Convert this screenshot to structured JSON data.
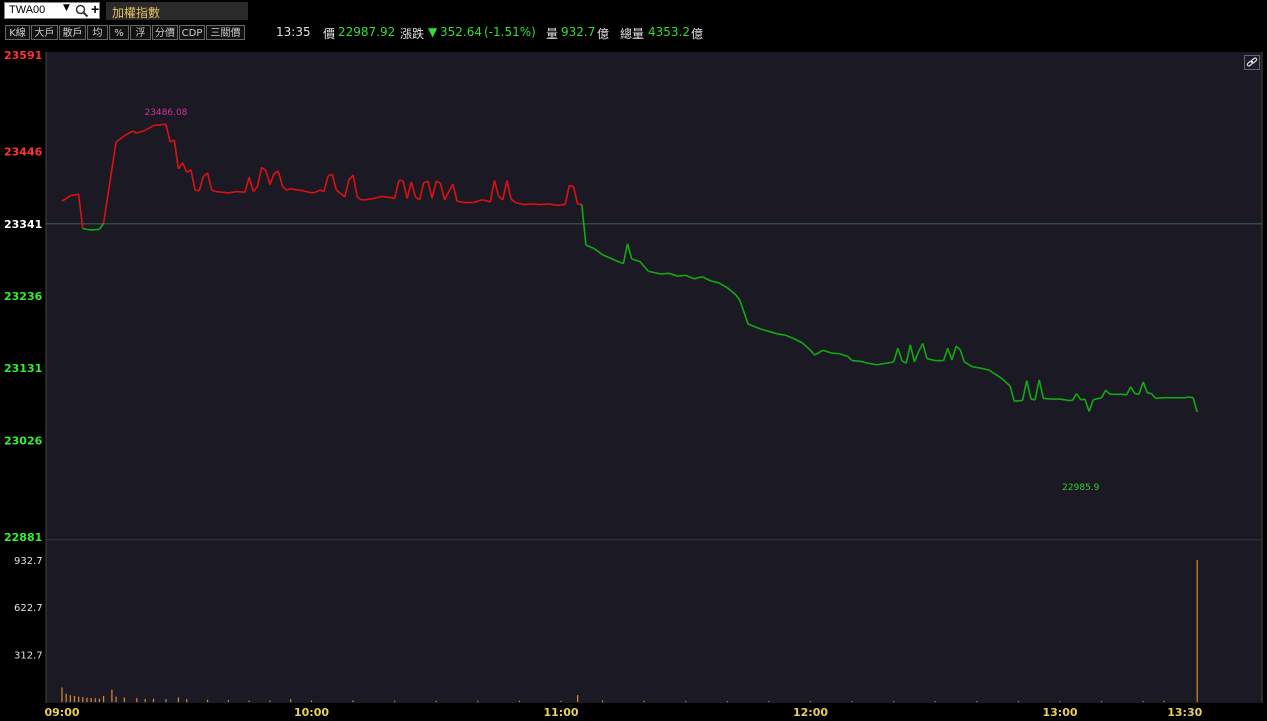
{
  "symbol": {
    "code": "TWA00",
    "title": "加權指數"
  },
  "toolbar": {
    "buttons": [
      "K線",
      "大戶",
      "散戶",
      "均",
      "%",
      "浮",
      "分價",
      "CDP",
      "三關價"
    ]
  },
  "quote": {
    "time": "13:35",
    "price_label": "價",
    "price": "22987.92",
    "change_label": "漲跌",
    "change_arrow": "▼",
    "change": "352.64",
    "change_pct": "(-1.51%)",
    "volume_label": "量",
    "volume": "932.7",
    "volume_unit": "億",
    "total_label": "總量",
    "total": "4353.2",
    "total_unit": "億"
  },
  "colors": {
    "up": "#dd1111",
    "down": "#11aa11",
    "reference": "#3a5a4a",
    "volume": "#e08a30",
    "high_label": "#cc3399",
    "low_label": "#33cc33",
    "background": "#1b1a24"
  },
  "chart_data": {
    "type": "line",
    "title": "加權指數",
    "x_ticks": [
      "09:00",
      "10:00",
      "11:00",
      "12:00",
      "13:00",
      "13:30"
    ],
    "y_ticks": [
      23591,
      23446,
      23341,
      23236,
      23131,
      23026,
      22881
    ],
    "ylim": [
      22881,
      23591
    ],
    "reference": 23341,
    "high": {
      "value": "23486.08",
      "time": "09:25"
    },
    "low": {
      "value": "22985.9",
      "time": "13:05"
    },
    "series": [
      {
        "values": [
          [
            "09:00",
            23374
          ],
          [
            "09:02",
            23382
          ],
          [
            "09:04",
            23384
          ],
          [
            "09:05",
            23334
          ],
          [
            "09:07",
            23332
          ],
          [
            "09:09",
            23333
          ],
          [
            "09:10",
            23342
          ],
          [
            "09:13",
            23460
          ],
          [
            "09:15",
            23469
          ],
          [
            "09:17",
            23476
          ],
          [
            "09:18",
            23473
          ],
          [
            "09:20",
            23477
          ],
          [
            "09:22",
            23484
          ],
          [
            "09:25",
            23486
          ],
          [
            "09:26",
            23460
          ],
          [
            "09:27",
            23463
          ],
          [
            "09:28",
            23421
          ],
          [
            "09:29",
            23430
          ],
          [
            "09:30",
            23416
          ],
          [
            "09:31",
            23420
          ],
          [
            "09:32",
            23390
          ],
          [
            "09:33",
            23389
          ],
          [
            "09:34",
            23410
          ],
          [
            "09:35",
            23415
          ],
          [
            "09:36",
            23390
          ],
          [
            "09:37",
            23388
          ],
          [
            "09:40",
            23386
          ],
          [
            "09:42",
            23388
          ],
          [
            "09:44",
            23387
          ],
          [
            "09:45",
            23409
          ],
          [
            "09:46",
            23388
          ],
          [
            "09:47",
            23395
          ],
          [
            "09:48",
            23423
          ],
          [
            "09:49",
            23419
          ],
          [
            "09:50",
            23398
          ],
          [
            "09:51",
            23414
          ],
          [
            "09:52",
            23418
          ],
          [
            "09:53",
            23396
          ],
          [
            "09:54",
            23390
          ],
          [
            "09:55",
            23392
          ],
          [
            "09:58",
            23389
          ],
          [
            "10:00",
            23386
          ],
          [
            "10:01",
            23387
          ],
          [
            "10:02",
            23390
          ],
          [
            "10:03",
            23388
          ],
          [
            "10:04",
            23411
          ],
          [
            "10:05",
            23413
          ],
          [
            "10:06",
            23390
          ],
          [
            "10:07",
            23385
          ],
          [
            "10:08",
            23380
          ],
          [
            "10:09",
            23405
          ],
          [
            "10:10",
            23412
          ],
          [
            "10:11",
            23380
          ],
          [
            "10:12",
            23376
          ],
          [
            "10:13",
            23376
          ],
          [
            "10:15",
            23378
          ],
          [
            "10:17",
            23381
          ],
          [
            "10:19",
            23379
          ],
          [
            "10:20",
            23378
          ],
          [
            "10:21",
            23404
          ],
          [
            "10:22",
            23404
          ],
          [
            "10:23",
            23378
          ],
          [
            "10:24",
            23402
          ],
          [
            "10:25",
            23380
          ],
          [
            "10:26",
            23376
          ],
          [
            "10:27",
            23401
          ],
          [
            "10:28",
            23403
          ],
          [
            "10:29",
            23378
          ],
          [
            "10:30",
            23403
          ],
          [
            "10:31",
            23400
          ],
          [
            "10:32",
            23376
          ],
          [
            "10:34",
            23399
          ],
          [
            "10:35",
            23374
          ],
          [
            "10:37",
            23372
          ],
          [
            "10:39",
            23372
          ],
          [
            "10:41",
            23376
          ],
          [
            "10:43",
            23373
          ],
          [
            "10:44",
            23404
          ],
          [
            "10:45",
            23381
          ],
          [
            "10:46",
            23376
          ],
          [
            "10:47",
            23404
          ],
          [
            "10:48",
            23377
          ],
          [
            "10:49",
            23372
          ],
          [
            "10:51",
            23369
          ],
          [
            "10:53",
            23370
          ],
          [
            "10:55",
            23369
          ],
          [
            "10:57",
            23370
          ],
          [
            "10:59",
            23368
          ],
          [
            "11:01",
            23369
          ],
          [
            "11:02",
            23397
          ],
          [
            "11:03",
            23395
          ],
          [
            "11:04",
            23370
          ],
          [
            "11:05",
            23369
          ],
          [
            "11:06",
            23310
          ],
          [
            "11:08",
            23305
          ],
          [
            "11:10",
            23296
          ],
          [
            "11:13",
            23288
          ],
          [
            "11:15",
            23283
          ],
          [
            "11:16",
            23312
          ],
          [
            "11:17",
            23290
          ],
          [
            "11:19",
            23286
          ],
          [
            "11:21",
            23272
          ],
          [
            "11:24",
            23268
          ],
          [
            "11:26",
            23269
          ],
          [
            "11:28",
            23265
          ],
          [
            "11:30",
            23266
          ],
          [
            "11:32",
            23261
          ],
          [
            "11:34",
            23264
          ],
          [
            "11:36",
            23258
          ],
          [
            "11:38",
            23255
          ],
          [
            "11:40",
            23248
          ],
          [
            "11:42",
            23238
          ],
          [
            "11:43",
            23230
          ],
          [
            "11:45",
            23195
          ],
          [
            "11:48",
            23188
          ],
          [
            "11:52",
            23181
          ],
          [
            "11:54",
            23179
          ],
          [
            "11:56",
            23174
          ],
          [
            "11:58",
            23168
          ],
          [
            "12:00",
            23157
          ],
          [
            "12:01",
            23150
          ],
          [
            "12:03",
            23157
          ],
          [
            "12:05",
            23153
          ],
          [
            "12:07",
            23152
          ],
          [
            "12:09",
            23148
          ],
          [
            "12:10",
            23142
          ],
          [
            "12:12",
            23141
          ],
          [
            "12:14",
            23138
          ],
          [
            "12:16",
            23136
          ],
          [
            "12:18",
            23138
          ],
          [
            "12:20",
            23140
          ],
          [
            "12:21",
            23160
          ],
          [
            "12:22",
            23142
          ],
          [
            "12:23",
            23138
          ],
          [
            "12:24",
            23165
          ],
          [
            "12:25",
            23140
          ],
          [
            "12:26",
            23155
          ],
          [
            "12:27",
            23167
          ],
          [
            "12:28",
            23145
          ],
          [
            "12:30",
            23142
          ],
          [
            "12:32",
            23142
          ],
          [
            "12:33",
            23160
          ],
          [
            "12:34",
            23143
          ],
          [
            "12:35",
            23163
          ],
          [
            "12:36",
            23158
          ],
          [
            "12:37",
            23140
          ],
          [
            "12:39",
            23133
          ],
          [
            "12:41",
            23131
          ],
          [
            "12:43",
            23128
          ],
          [
            "12:46",
            23116
          ],
          [
            "12:48",
            23105
          ],
          [
            "12:49",
            23083
          ],
          [
            "12:51",
            23084
          ],
          [
            "12:52",
            23113
          ],
          [
            "12:53",
            23086
          ],
          [
            "12:54",
            23085
          ],
          [
            "12:55",
            23114
          ],
          [
            "12:56",
            23087
          ],
          [
            "12:58",
            23086
          ],
          [
            "13:00",
            23086
          ],
          [
            "13:02",
            23084
          ],
          [
            "13:03",
            23084
          ],
          [
            "13:04",
            23094
          ],
          [
            "13:05",
            23085
          ],
          [
            "13:06",
            23086
          ],
          [
            "13:07",
            23068
          ],
          [
            "13:08",
            23085
          ],
          [
            "13:10",
            23088
          ],
          [
            "13:11",
            23099
          ],
          [
            "13:12",
            23093
          ],
          [
            "13:15",
            23093
          ],
          [
            "13:16",
            23092
          ],
          [
            "13:17",
            23104
          ],
          [
            "13:18",
            23094
          ],
          [
            "13:19",
            23093
          ],
          [
            "13:20",
            23111
          ],
          [
            "13:21",
            23095
          ],
          [
            "13:22",
            23094
          ],
          [
            "13:23",
            23087
          ],
          [
            "13:25",
            23088
          ],
          [
            "13:28",
            23088
          ],
          [
            "13:30",
            23088
          ],
          [
            "13:31",
            23089
          ],
          [
            "13:32",
            23088
          ],
          [
            "13:33",
            23067
          ]
        ]
      }
    ],
    "volume": {
      "y_ticks": [
        "932.7",
        "622.7",
        "312.7"
      ],
      "ylim": [
        0,
        932.7
      ],
      "values": [
        [
          "09:00",
          95
        ],
        [
          "09:01",
          55
        ],
        [
          "09:02",
          45
        ],
        [
          "09:03",
          40
        ],
        [
          "09:04",
          35
        ],
        [
          "09:05",
          32
        ],
        [
          "09:06",
          28
        ],
        [
          "09:07",
          26
        ],
        [
          "09:08",
          25
        ],
        [
          "09:09",
          22
        ],
        [
          "09:10",
          40
        ],
        [
          "09:12",
          80
        ],
        [
          "09:13",
          35
        ],
        [
          "09:15",
          30
        ],
        [
          "09:18",
          25
        ],
        [
          "09:20",
          20
        ],
        [
          "09:22",
          22
        ],
        [
          "09:25",
          20
        ],
        [
          "09:28",
          30
        ],
        [
          "09:30",
          18
        ],
        [
          "09:35",
          15
        ],
        [
          "09:40",
          12
        ],
        [
          "09:45",
          10
        ],
        [
          "09:50",
          10
        ],
        [
          "09:55",
          18
        ],
        [
          "10:00",
          10
        ],
        [
          "10:10",
          10
        ],
        [
          "10:20",
          8
        ],
        [
          "10:30",
          8
        ],
        [
          "10:40",
          8
        ],
        [
          "10:50",
          8
        ],
        [
          "11:00",
          8
        ],
        [
          "11:04",
          45
        ],
        [
          "11:10",
          10
        ],
        [
          "11:20",
          8
        ],
        [
          "11:30",
          6
        ],
        [
          "11:40",
          6
        ],
        [
          "11:50",
          6
        ],
        [
          "12:00",
          6
        ],
        [
          "12:10",
          6
        ],
        [
          "12:20",
          6
        ],
        [
          "12:30",
          6
        ],
        [
          "12:40",
          6
        ],
        [
          "12:50",
          6
        ],
        [
          "13:00",
          5
        ],
        [
          "13:10",
          6
        ],
        [
          "13:20",
          6
        ],
        [
          "13:25",
          8
        ],
        [
          "13:33",
          932.7
        ]
      ]
    }
  }
}
